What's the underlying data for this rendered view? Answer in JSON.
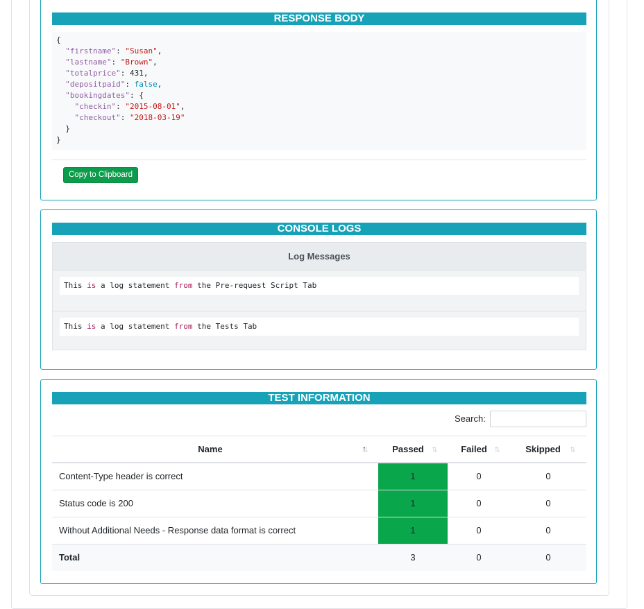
{
  "response_body": {
    "title": "RESPONSE BODY",
    "json_lines": [
      {
        "indent": 0,
        "parts": [
          {
            "t": "{",
            "c": "n"
          }
        ]
      },
      {
        "indent": 1,
        "parts": [
          {
            "t": "\"firstname\"",
            "c": "k"
          },
          {
            "t": ": ",
            "c": "n"
          },
          {
            "t": "\"Susan\"",
            "c": "s"
          },
          {
            "t": ",",
            "c": "n"
          }
        ]
      },
      {
        "indent": 1,
        "parts": [
          {
            "t": "\"lastname\"",
            "c": "k"
          },
          {
            "t": ": ",
            "c": "n"
          },
          {
            "t": "\"Brown\"",
            "c": "s"
          },
          {
            "t": ",",
            "c": "n"
          }
        ]
      },
      {
        "indent": 1,
        "parts": [
          {
            "t": "\"totalprice\"",
            "c": "k"
          },
          {
            "t": ": ",
            "c": "n"
          },
          {
            "t": "431",
            "c": "n"
          },
          {
            "t": ",",
            "c": "n"
          }
        ]
      },
      {
        "indent": 1,
        "parts": [
          {
            "t": "\"depositpaid\"",
            "c": "k"
          },
          {
            "t": ": ",
            "c": "n"
          },
          {
            "t": "false",
            "c": "b"
          },
          {
            "t": ",",
            "c": "n"
          }
        ]
      },
      {
        "indent": 1,
        "parts": [
          {
            "t": "\"bookingdates\"",
            "c": "k"
          },
          {
            "t": ": {",
            "c": "n"
          }
        ]
      },
      {
        "indent": 2,
        "parts": [
          {
            "t": "\"checkin\"",
            "c": "k"
          },
          {
            "t": ": ",
            "c": "n"
          },
          {
            "t": "\"2015-08-01\"",
            "c": "s"
          },
          {
            "t": ",",
            "c": "n"
          }
        ]
      },
      {
        "indent": 2,
        "parts": [
          {
            "t": "\"checkout\"",
            "c": "k"
          },
          {
            "t": ": ",
            "c": "n"
          },
          {
            "t": "\"2018-03-19\"",
            "c": "s"
          }
        ]
      },
      {
        "indent": 1,
        "parts": [
          {
            "t": "}",
            "c": "n"
          }
        ]
      },
      {
        "indent": 0,
        "parts": [
          {
            "t": "}",
            "c": "n"
          }
        ]
      }
    ],
    "copy_button": "Copy to Clipboard"
  },
  "console_logs": {
    "title": "CONSOLE LOGS",
    "header": "Log Messages",
    "messages": [
      [
        {
          "t": "This ",
          "c": "n"
        },
        {
          "t": "is",
          "c": "kw"
        },
        {
          "t": " a log statement ",
          "c": "n"
        },
        {
          "t": "from",
          "c": "kw"
        },
        {
          "t": " the Pre-request Script Tab",
          "c": "n"
        }
      ],
      [
        {
          "t": "This ",
          "c": "n"
        },
        {
          "t": "is",
          "c": "kw"
        },
        {
          "t": " a log statement ",
          "c": "n"
        },
        {
          "t": "from",
          "c": "kw"
        },
        {
          "t": " the Tests Tab",
          "c": "n"
        }
      ]
    ]
  },
  "test_information": {
    "title": "TEST INFORMATION",
    "search_label": "Search:",
    "search_value": "",
    "columns": [
      "Name",
      "Passed",
      "Failed",
      "Skipped"
    ],
    "rows": [
      {
        "name": "Content-Type header is correct",
        "passed": "1",
        "failed": "0",
        "skipped": "0"
      },
      {
        "name": "Status code is 200",
        "passed": "1",
        "failed": "0",
        "skipped": "0"
      },
      {
        "name": "Without Additional Needs - Response data format is correct",
        "passed": "1",
        "failed": "0",
        "skipped": "0"
      }
    ],
    "total": {
      "name": "Total",
      "passed": "3",
      "failed": "0",
      "skipped": "0"
    }
  },
  "colors": {
    "section_header": "#17a2b8",
    "passed_cell": "#0aa64c",
    "copy_button": "#0c9c4c"
  }
}
